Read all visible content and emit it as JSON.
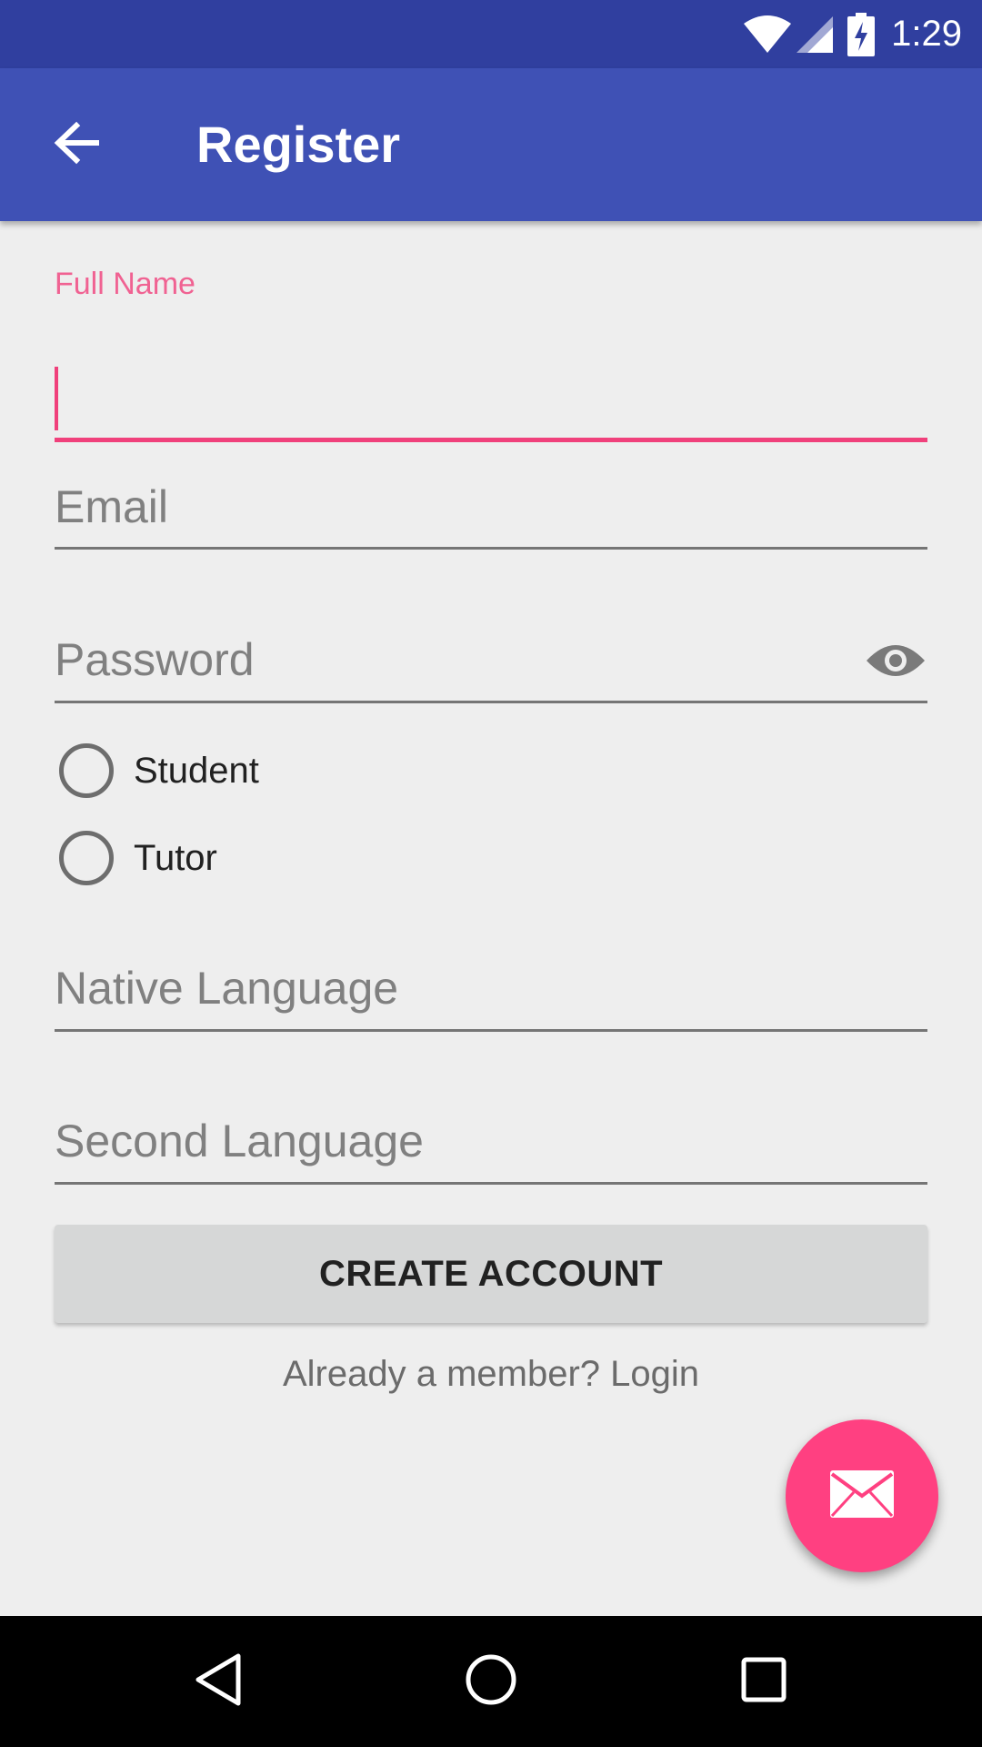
{
  "status_bar": {
    "time": "1:29",
    "icons": [
      "wifi-icon",
      "cell-signal-icon",
      "battery-charging-icon"
    ]
  },
  "app_bar": {
    "title": "Register",
    "back_icon": "arrow-back-icon"
  },
  "form": {
    "full_name": {
      "label": "Full Name",
      "value": ""
    },
    "email": {
      "placeholder": "Email"
    },
    "password": {
      "placeholder": "Password",
      "toggle_icon": "eye-icon"
    },
    "role_options": [
      {
        "label": "Student",
        "selected": false
      },
      {
        "label": "Tutor",
        "selected": false
      }
    ],
    "native_language": {
      "placeholder": "Native Language"
    },
    "second_language": {
      "placeholder": "Second Language"
    },
    "create_button_label": "CREATE ACCOUNT",
    "login_link": "Already a member? Login"
  },
  "fab": {
    "icon": "mail-icon"
  },
  "nav_bar": {
    "buttons": [
      "back-triangle-icon",
      "home-circle-icon",
      "recents-square-icon"
    ]
  },
  "colors": {
    "status_bar": "#303f9f",
    "app_bar": "#3f51b5",
    "accent": "#ff4081",
    "background": "#eeeeee"
  }
}
